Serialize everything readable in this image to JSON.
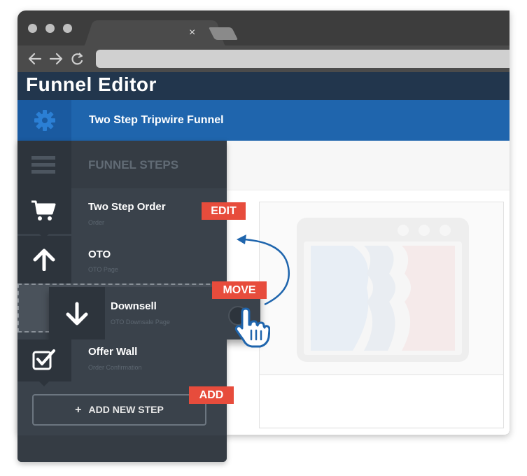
{
  "app": {
    "title": "Funnel Editor"
  },
  "funnel": {
    "name": "Two Step Tripwire Funnel"
  },
  "sidebar": {
    "header": "FUNNEL STEPS",
    "steps": [
      {
        "name": "Two Step Order",
        "type": "Order",
        "icon": "cart-icon"
      },
      {
        "name": "OTO",
        "type": "OTO Page",
        "icon": "arrow-up-icon"
      },
      {
        "name": "Downsell",
        "type": "OTO Downsale Page",
        "icon": "arrow-down-icon"
      },
      {
        "name": "Offer Wall",
        "type": "Order Confirmation",
        "icon": "checkbox-icon"
      }
    ],
    "add_button": "ADD NEW STEP"
  },
  "callouts": {
    "edit": "EDIT",
    "move": "MOVE",
    "add": "ADD"
  },
  "browser": {
    "tab_close": "×"
  },
  "colors": {
    "accent": "#1f65ad",
    "callout": "#e74c3c",
    "sidebar": "#3a424b",
    "titlebar": "#22364d"
  }
}
